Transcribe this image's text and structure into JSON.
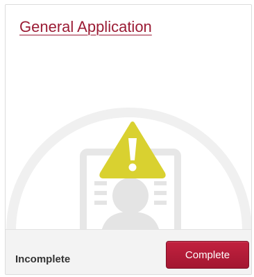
{
  "card": {
    "title": "General Application",
    "status": "Incomplete",
    "action_label": "Complete"
  },
  "icons": {
    "warning": "warning-triangle-icon",
    "document": "profile-document-icon"
  },
  "colors": {
    "brand": "#9b1c35",
    "button": "#b51d39",
    "warning": "#d9d130"
  }
}
